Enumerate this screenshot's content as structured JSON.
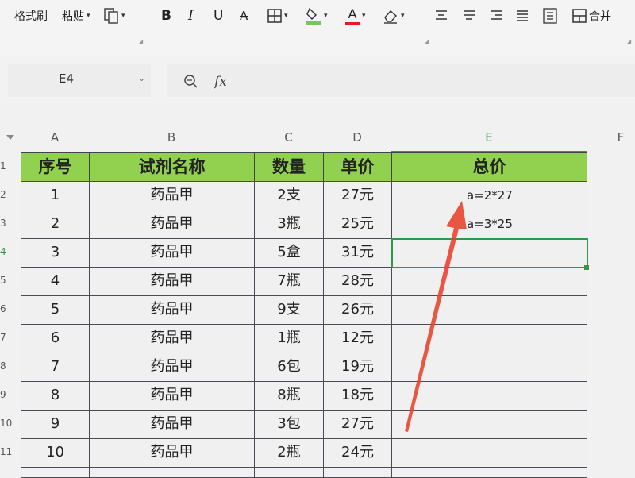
{
  "toolbar": {
    "format_painter": "格式刷",
    "paste": "粘贴",
    "bold": "B",
    "italic": "I",
    "underline": "U",
    "strike": "A",
    "font_color": "A",
    "merge": "合并",
    "highlight_color": "#7cc45a",
    "font_color_bar": "#e02020"
  },
  "formula_bar": {
    "cell_ref": "E4",
    "fx": "fx",
    "formula": ""
  },
  "columns": [
    "A",
    "B",
    "C",
    "D",
    "E",
    "F"
  ],
  "rows": [
    "1",
    "2",
    "3",
    "4",
    "5",
    "6",
    "7",
    "8",
    "9",
    "10",
    "11"
  ],
  "table": {
    "headers": [
      "序号",
      "试剂名称",
      "数量",
      "单价",
      "总价"
    ],
    "body": [
      [
        "1",
        "药品甲",
        "2支",
        "27元",
        "a=2*27"
      ],
      [
        "2",
        "药品甲",
        "3瓶",
        "25元",
        "a=3*25"
      ],
      [
        "3",
        "药品甲",
        "5盒",
        "31元",
        ""
      ],
      [
        "4",
        "药品甲",
        "7瓶",
        "28元",
        ""
      ],
      [
        "5",
        "药品甲",
        "9支",
        "26元",
        ""
      ],
      [
        "6",
        "药品甲",
        "1瓶",
        "12元",
        ""
      ],
      [
        "7",
        "药品甲",
        "6包",
        "19元",
        ""
      ],
      [
        "8",
        "药品甲",
        "8瓶",
        "18元",
        ""
      ],
      [
        "9",
        "药品甲",
        "3包",
        "27元",
        ""
      ],
      [
        "10",
        "药品甲",
        "2瓶",
        "24元",
        ""
      ]
    ],
    "header_color": "#92d050"
  },
  "colors": {
    "selection": "#2e9a48",
    "arrow": "#e8452f"
  }
}
